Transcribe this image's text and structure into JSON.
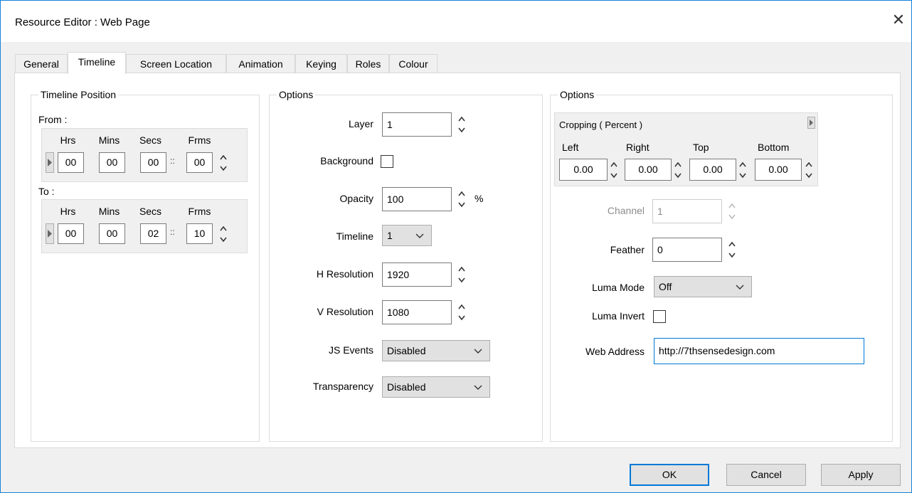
{
  "window": {
    "title": "Resource Editor  :  Web Page",
    "close_glyph": "✕"
  },
  "tabs": [
    "General",
    "Timeline",
    "Screen Location",
    "Animation",
    "Keying",
    "Roles",
    "Colour"
  ],
  "timeline_position": {
    "legend": "Timeline Position",
    "from_label": "From :",
    "to_label": "To :",
    "headers": [
      "Hrs",
      "Mins",
      "Secs",
      "Frms"
    ],
    "from": [
      "00",
      "00",
      "00",
      "00"
    ],
    "to": [
      "00",
      "00",
      "02",
      "10"
    ],
    "separator": "::"
  },
  "options_center": {
    "legend": "Options",
    "layer_label": "Layer",
    "layer_value": "1",
    "background_label": "Background",
    "opacity_label": "Opacity",
    "opacity_value": "100",
    "opacity_unit": "%",
    "timeline_label": "Timeline",
    "timeline_value": "1",
    "hres_label": "H Resolution",
    "hres_value": "1920",
    "vres_label": "V Resolution",
    "vres_value": "1080",
    "js_label": "JS Events",
    "js_value": "Disabled",
    "transparency_label": "Transparency",
    "transparency_value": "Disabled"
  },
  "options_right": {
    "legend": "Options",
    "cropping_title": "Cropping ( Percent )",
    "crop_headers": [
      "Left",
      "Right",
      "Top",
      "Bottom"
    ],
    "crop_values": [
      "0.00",
      "0.00",
      "0.00",
      "0.00"
    ],
    "channel_label": "Channel",
    "channel_value": "1",
    "feather_label": "Feather",
    "feather_value": "0",
    "luma_mode_label": "Luma Mode",
    "luma_mode_value": "Off",
    "luma_invert_label": "Luma Invert",
    "web_address_label": "Web Address",
    "web_address_value": "http://7thsensedesign.com"
  },
  "buttons": {
    "ok": "OK",
    "cancel": "Cancel",
    "apply": "Apply"
  },
  "colors": {
    "accent": "#0078d7",
    "window_border": "#1883d7"
  }
}
